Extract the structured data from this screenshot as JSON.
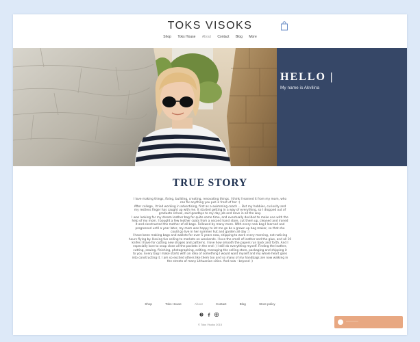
{
  "site": {
    "title": "TOKS VISOKS"
  },
  "nav": {
    "items": [
      "Shop",
      "Toks House",
      "About",
      "Contact",
      "Blog",
      "More"
    ],
    "active": "About"
  },
  "hero": {
    "heading": "HELLO |",
    "subheading": "My name is Akvilina",
    "panel_color": "#364767"
  },
  "story": {
    "title": "TRUE STORY",
    "lines": [
      "I love making things, fixing, building, creating, renovating things. I think I learned it from my mom, who",
      "can fix anything you put in front of her :)",
      "After college, I tried working in advertising, first as a swimming coach ... But my hobbies, curiosity and",
      "my restless finger has caught up with me. It started getting in a way of everything, so I dropped out of",
      "graduate school, said goodbye to my day job and dove in all the way.",
      "I was looking for my dream leather bag for quite some time, and eventually decided to make one with the",
      "help of my mom. I bought a few leather coats from a second hand store, cut them up, cleaned and ironed",
      "it and constructed the mother of all bags. Followed by many more. With every new bag I learned and",
      "progressed until a year later, my mom was happy to let me go be a grown up bag maker, so that she",
      "could go live in her summer hut and garden all day :)",
      "I have been making bags and wallets for over 5 years now, shipping to work every morning, not noticing",
      "hours flying by. Having fun selling to markets on weekends. I love the smell of leather and the glue, and all 10",
      "knifes I have for cutting new shapes and patterns. I love how smooth the papers run back and forth. And I",
      "especially love to snap close all the pockets in the end :) I still do everything myself. Finding the leather,",
      "cutting, sewing, finishing, photographing, editing, managing the selling store, packaging and shipping it",
      "to you. Every bag I make starts with an idea of something I would want myself and my whole heart goes",
      "into constructing it. I am so excited others like them too and so many of my handbags are now walking in",
      "the streets of many Lithuanian cities. And now - beyond :)"
    ]
  },
  "footer": {
    "nav": [
      "Shop",
      "Toks House",
      "About",
      "Contact",
      "Blog",
      "Store policy"
    ],
    "active": "About",
    "copyright": "© Toks Visoks 2015"
  },
  "colors": {
    "background": "#dde9f8",
    "navy": "#1f3150",
    "chat": "#e8a882"
  },
  "icons": {
    "cart": "shopping-bag-icon",
    "social": [
      "pinterest-icon",
      "facebook-icon",
      "instagram-icon"
    ],
    "chat": "chat-icon"
  }
}
